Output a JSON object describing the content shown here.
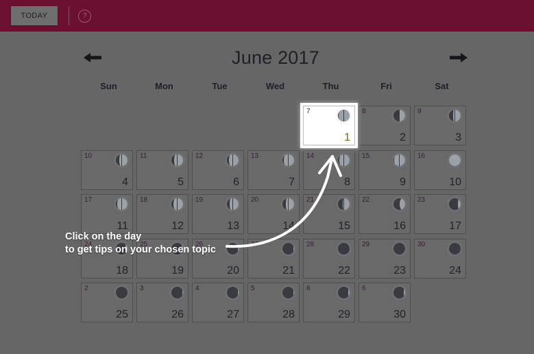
{
  "topbar": {
    "today_label": "TODAY",
    "help_label": "?",
    "background_color": "#6b1030",
    "button_color": "#6e6e6e"
  },
  "nav": {
    "prev_label": "←",
    "next_label": "→"
  },
  "header": {
    "month_title": "June 2017"
  },
  "weekdays": [
    "Sun",
    "Mon",
    "Tue",
    "Wed",
    "Thu",
    "Fri",
    "Sat"
  ],
  "annotation": {
    "line1": "Click on the day",
    "line2": "to get tips on your chosen topic",
    "color": "#ffffff"
  },
  "calendar": {
    "selected_day": 1,
    "weeks": [
      [
        {
          "empty": true
        },
        {
          "empty": true
        },
        {
          "empty": true
        },
        {
          "empty": true
        },
        {
          "topic": "7",
          "day": "1",
          "phase": 0.97,
          "selected": true
        },
        {
          "topic": "8",
          "day": "2",
          "phase": 0.5
        },
        {
          "topic": "9",
          "day": "3",
          "phase": 0.62
        }
      ],
      [
        {
          "topic": "10",
          "day": "4",
          "phase": 0.72
        },
        {
          "topic": "11",
          "day": "5",
          "phase": 0.78
        },
        {
          "topic": "12",
          "day": "6",
          "phase": 0.82
        },
        {
          "topic": "13",
          "day": "7",
          "phase": 0.86
        },
        {
          "topic": "14",
          "day": "8",
          "phase": 0.9
        },
        {
          "topic": "15",
          "day": "9",
          "phase": 0.95
        },
        {
          "topic": "16",
          "day": "10",
          "phase": 0.99
        }
      ],
      [
        {
          "topic": "17",
          "day": "11",
          "phase": 0.9
        },
        {
          "topic": "18",
          "day": "12",
          "phase": 0.84
        },
        {
          "topic": "19",
          "day": "13",
          "phase": 0.76
        },
        {
          "topic": "20",
          "day": "14",
          "phase": 0.68
        },
        {
          "topic": "21",
          "day": "15",
          "phase": 0.6
        },
        {
          "topic": "22",
          "day": "16",
          "phase": 0.48
        },
        {
          "topic": "23",
          "day": "17",
          "phase": 0.22
        }
      ],
      [
        {
          "topic": "24",
          "day": "18",
          "phase": 0.16
        },
        {
          "topic": "25",
          "day": "19",
          "phase": 0.12
        },
        {
          "topic": "26",
          "day": "20",
          "phase": 0.07
        },
        {
          "topic": "27",
          "day": "21",
          "phase": 0.04
        },
        {
          "topic": "28",
          "day": "22",
          "phase": 0.02
        },
        {
          "topic": "29",
          "day": "23",
          "phase": 0.01
        },
        {
          "topic": "30",
          "day": "24",
          "phase": 0.01
        }
      ],
      [
        {
          "topic": "2",
          "day": "25",
          "phase": 0.02
        },
        {
          "topic": "3",
          "day": "26",
          "phase": 0.03
        },
        {
          "topic": "4",
          "day": "27",
          "phase": 0.05
        },
        {
          "topic": "5",
          "day": "28",
          "phase": 0.07
        },
        {
          "topic": "6",
          "day": "29",
          "phase": 0.09
        },
        {
          "topic": "6",
          "day": "30",
          "phase": 0.12
        },
        {
          "empty": true
        }
      ]
    ]
  }
}
